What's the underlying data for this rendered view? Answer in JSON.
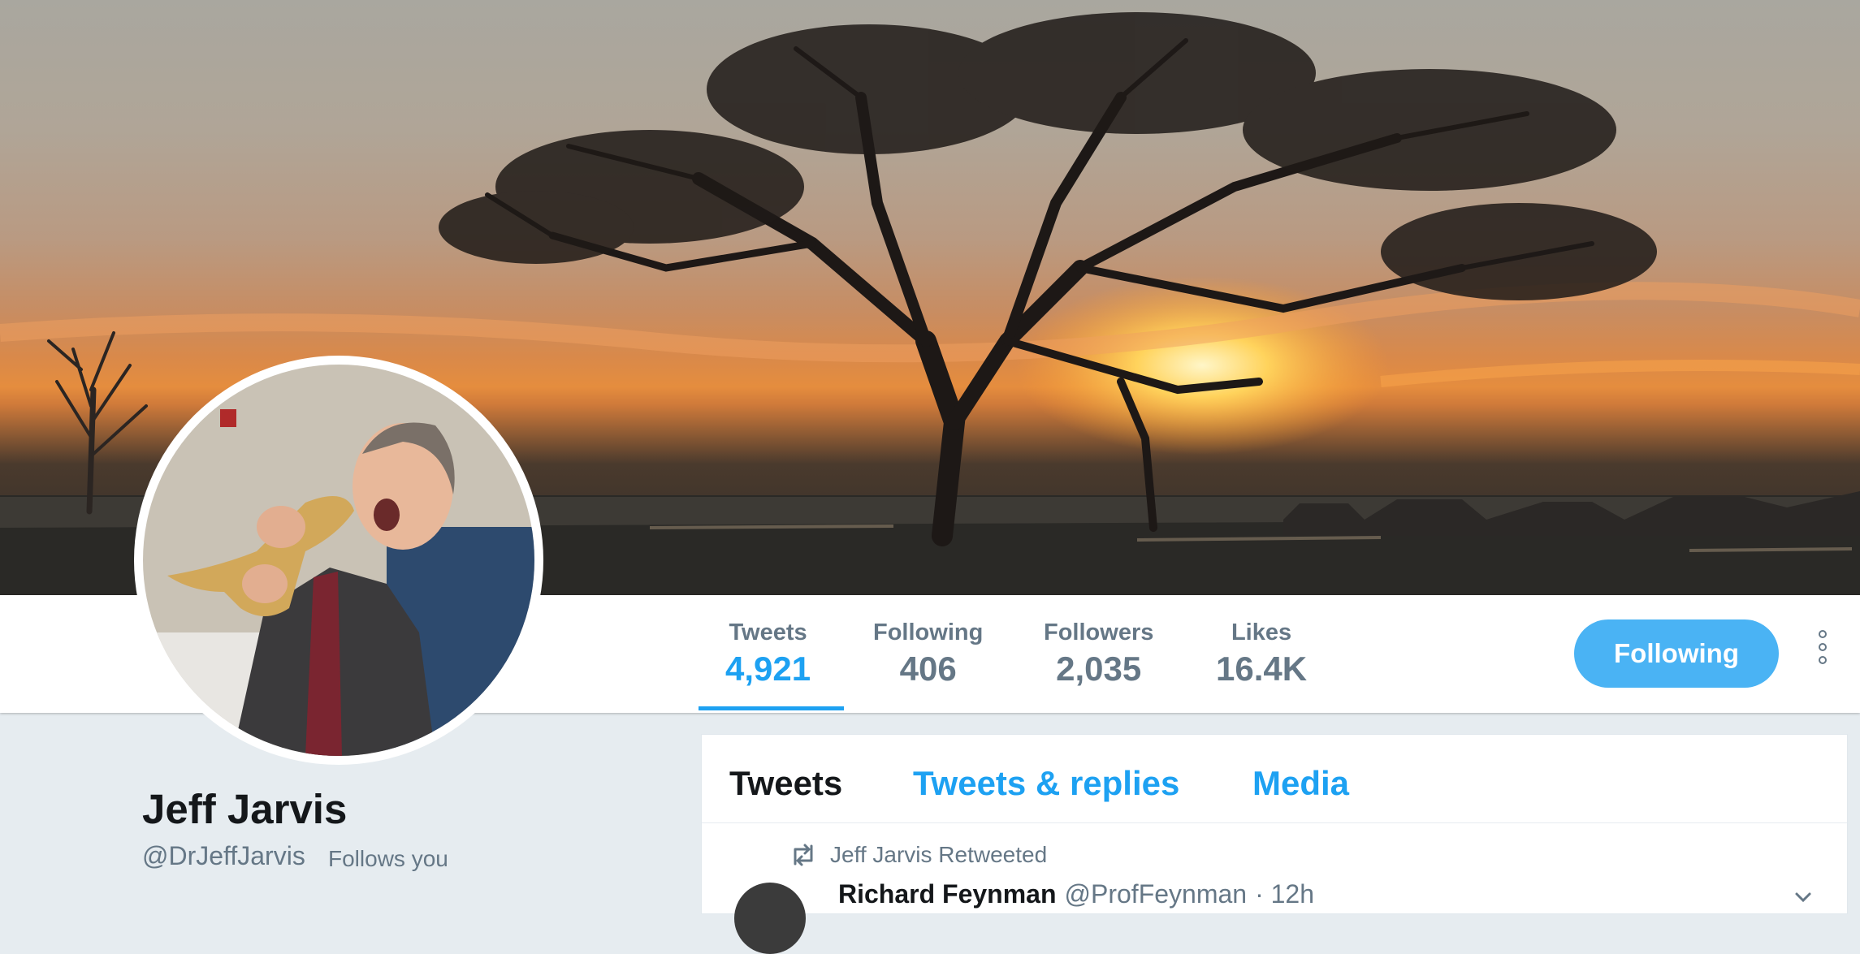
{
  "profile": {
    "name": "Jeff Jarvis",
    "handle": "@DrJeffJarvis",
    "follows_you": "Follows you"
  },
  "stats": [
    {
      "label": "Tweets",
      "value": "4,921"
    },
    {
      "label": "Following",
      "value": "406"
    },
    {
      "label": "Followers",
      "value": "2,035"
    },
    {
      "label": "Likes",
      "value": "16.4K"
    }
  ],
  "actions": {
    "follow_label": "Following"
  },
  "timeline": {
    "tabs": [
      {
        "label": "Tweets"
      },
      {
        "label": "Tweets & replies"
      },
      {
        "label": "Media"
      }
    ],
    "retweet_label": "Jeff Jarvis Retweeted",
    "tweet": {
      "author": "Richard Feynman",
      "handle": "@ProfFeynman",
      "time": "· 12h"
    }
  },
  "colors": {
    "accent": "#1da1f2",
    "button": "#4ab3f4",
    "muted": "#657786",
    "background": "#e6ecf0"
  },
  "icons": [
    "retweet-icon",
    "more-options-icon",
    "chevron-down-icon"
  ]
}
